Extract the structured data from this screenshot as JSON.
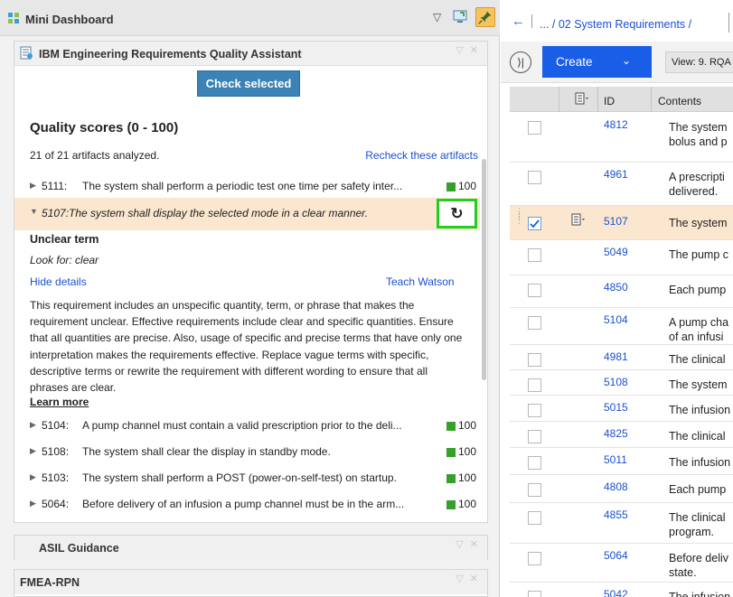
{
  "dashboard": {
    "title": "Mini Dashboard",
    "chevron": "▽"
  },
  "rqa": {
    "title": "IBM Engineering Requirements Quality Assistant",
    "check_button": "Check selected",
    "quality_title": "Quality scores (0 - 100)",
    "analyzed": "21 of 21 artifacts analyzed.",
    "recheck_link": "Recheck these artifacts",
    "top_row": {
      "id": "5111:",
      "text": "The system shall perform a periodic test one time per safety inter...",
      "score": "100"
    },
    "selected_row": {
      "id": "5107:",
      "text": "The system shall display the selected mode in a clear manner."
    },
    "issue_title": "Unclear term",
    "look_for": "Look for: clear",
    "hide_details": "Hide details",
    "teach_watson": "Teach Watson",
    "description": "This requirement includes an unspecific quantity, term, or phrase that makes the requirement unclear. Effective requirements include clear and specific quantities. Ensure that all quantities are precise. Also, usage of specific and precise terms that have only one interpretation makes the requirements effective. Replace vague terms with specific, descriptive terms or rewrite the requirement with different wording to ensure that all phrases are clear.",
    "learn_more": "Learn more",
    "rows": [
      {
        "id": "5104:",
        "text": "A pump channel must contain a valid prescription prior to the deli...",
        "score": "100"
      },
      {
        "id": "5108:",
        "text": "The system shall clear the display in standby mode.",
        "score": "100"
      },
      {
        "id": "5103:",
        "text": "The system shall perform a POST (power-on-self-test) on startup.",
        "score": "100"
      },
      {
        "id": "5064:",
        "text": "Before delivery of an infusion a pump channel must be in the arm...",
        "score": "100"
      }
    ]
  },
  "asil": {
    "title": "ASIL Guidance"
  },
  "fmea": {
    "title": "FMEA-RPN"
  },
  "requirements": {
    "breadcrumb": "... / 02 System Requirements /",
    "create_label": "Create",
    "view_label": "View: 9. RQA",
    "col_id": "ID",
    "col_contents": "Contents",
    "rows": [
      {
        "id": "4812",
        "text": "The system\nbolus and p"
      },
      {
        "id": "4961",
        "text": "A prescripti\ndelivered."
      },
      {
        "id": "5107",
        "text": "The system"
      },
      {
        "id": "5049",
        "text": "The pump c"
      },
      {
        "id": "4850",
        "text": "Each pump"
      },
      {
        "id": "5104",
        "text": "A pump cha\nof an infusi"
      },
      {
        "id": "4981",
        "text": "The clinical"
      },
      {
        "id": "5108",
        "text": "The system"
      },
      {
        "id": "5015",
        "text": "The infusion"
      },
      {
        "id": "4825",
        "text": "The clinical"
      },
      {
        "id": "5011",
        "text": "The infusion"
      },
      {
        "id": "4808",
        "text": "Each pump"
      },
      {
        "id": "4855",
        "text": "The clinical\nprogram."
      },
      {
        "id": "5064",
        "text": "Before deliv\nstate."
      },
      {
        "id": "5042",
        "text": "The infusion"
      }
    ]
  },
  "colors": {
    "accent_blue": "#1a5ee8",
    "check_button": "#3b83b7",
    "selection_bg": "#fbe7cf",
    "score_green": "#35a02b",
    "highlight_green": "#1fd11f"
  }
}
